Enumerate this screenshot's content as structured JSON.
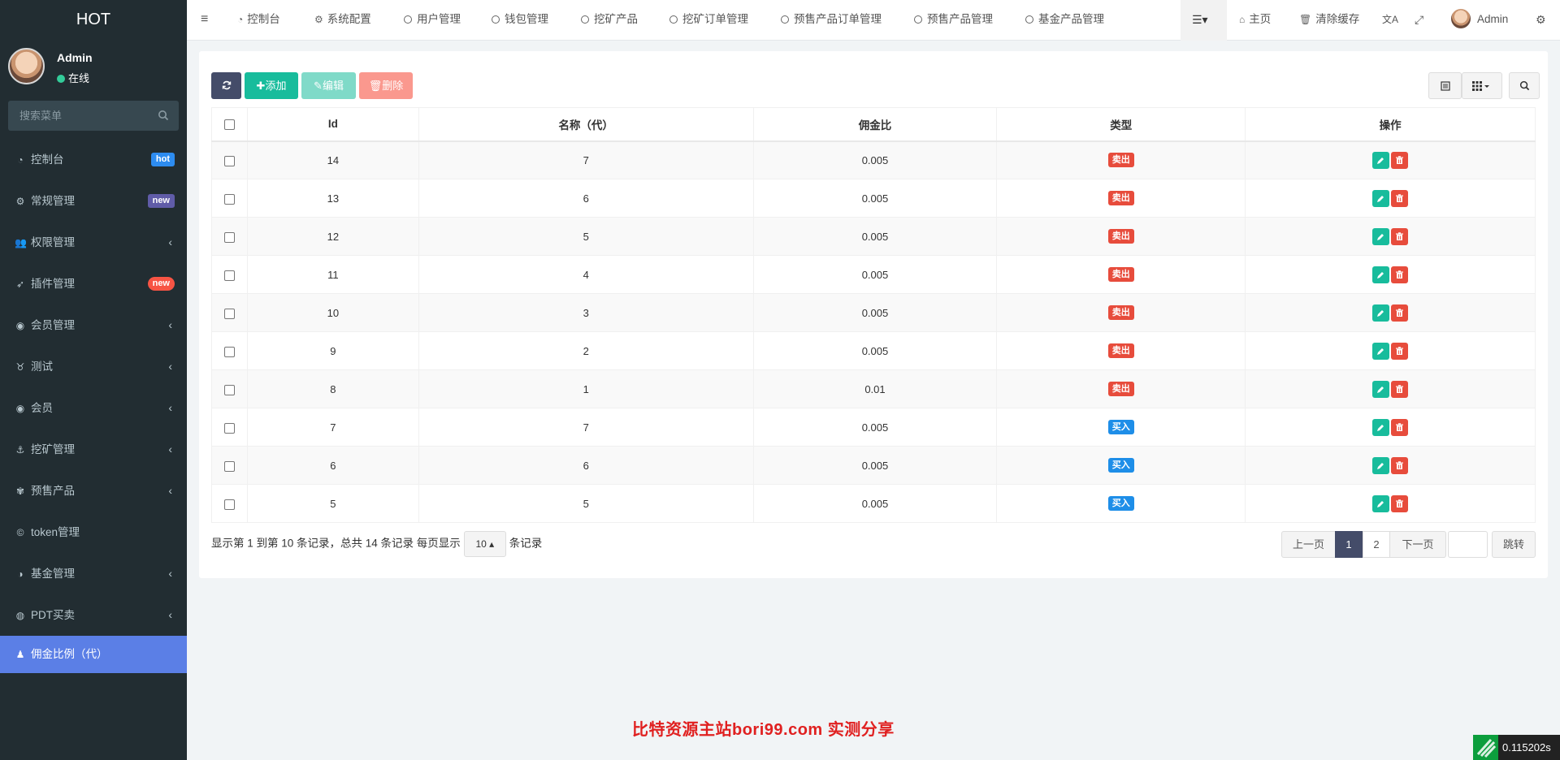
{
  "sidebar": {
    "logo": "HOT",
    "user_name": "Admin",
    "user_status": "在线",
    "search_placeholder": "搜索菜单",
    "items": [
      {
        "label": "控制台",
        "badge": "hot",
        "badge_color": "#2d8cf0"
      },
      {
        "label": "常规管理",
        "badge": "new",
        "badge_color": "#605ca8"
      },
      {
        "label": "权限管理"
      },
      {
        "label": "插件管理",
        "badge": "new",
        "badge_color": "#f75444"
      },
      {
        "label": "会员管理"
      },
      {
        "label": "测试"
      },
      {
        "label": "会员"
      },
      {
        "label": "挖矿管理"
      },
      {
        "label": "预售产品"
      },
      {
        "label": "token管理"
      },
      {
        "label": "基金管理"
      },
      {
        "label": "PDT买卖"
      },
      {
        "label": "佣金比例（代）"
      }
    ]
  },
  "topbar": {
    "tabs": [
      "控制台",
      "系统配置",
      "用户管理",
      "钱包管理",
      "挖矿产品",
      "挖矿订单管理",
      "预售产品订单管理",
      "预售产品管理",
      "基金产品管理"
    ],
    "home": "主页",
    "clear_cache": "清除缓存",
    "admin": "Admin"
  },
  "toolbar": {
    "add": "添加",
    "edit": "编辑",
    "delete": "删除"
  },
  "table": {
    "headers": [
      "Id",
      "名称（代）",
      "佣金比",
      "类型",
      "操作"
    ],
    "rows": [
      {
        "id": "14",
        "name": "7",
        "ratio": "0.005",
        "type": "卖出"
      },
      {
        "id": "13",
        "name": "6",
        "ratio": "0.005",
        "type": "卖出"
      },
      {
        "id": "12",
        "name": "5",
        "ratio": "0.005",
        "type": "卖出"
      },
      {
        "id": "11",
        "name": "4",
        "ratio": "0.005",
        "type": "卖出"
      },
      {
        "id": "10",
        "name": "3",
        "ratio": "0.005",
        "type": "卖出"
      },
      {
        "id": "9",
        "name": "2",
        "ratio": "0.005",
        "type": "卖出"
      },
      {
        "id": "8",
        "name": "1",
        "ratio": "0.01",
        "type": "卖出"
      },
      {
        "id": "7",
        "name": "7",
        "ratio": "0.005",
        "type": "买入"
      },
      {
        "id": "6",
        "name": "6",
        "ratio": "0.005",
        "type": "买入"
      },
      {
        "id": "5",
        "name": "5",
        "ratio": "0.005",
        "type": "买入"
      }
    ]
  },
  "pagination": {
    "info_prefix": "显示第 1 到第 10 条记录，总共 14 条记录 每页显示",
    "page_size": "10",
    "info_suffix": "条记录",
    "prev": "上一页",
    "page1": "1",
    "page2": "2",
    "next": "下一页",
    "jump": "跳转"
  },
  "watermark": "比特资源主站bori99.com  实测分享",
  "timer": "0.115202s",
  "colors": {
    "sidebar_bg": "#222d32",
    "active_menu": "#5b7fe6",
    "success": "#18bc9c",
    "danger": "#e74c3c",
    "primary": "#1e8ee8"
  }
}
